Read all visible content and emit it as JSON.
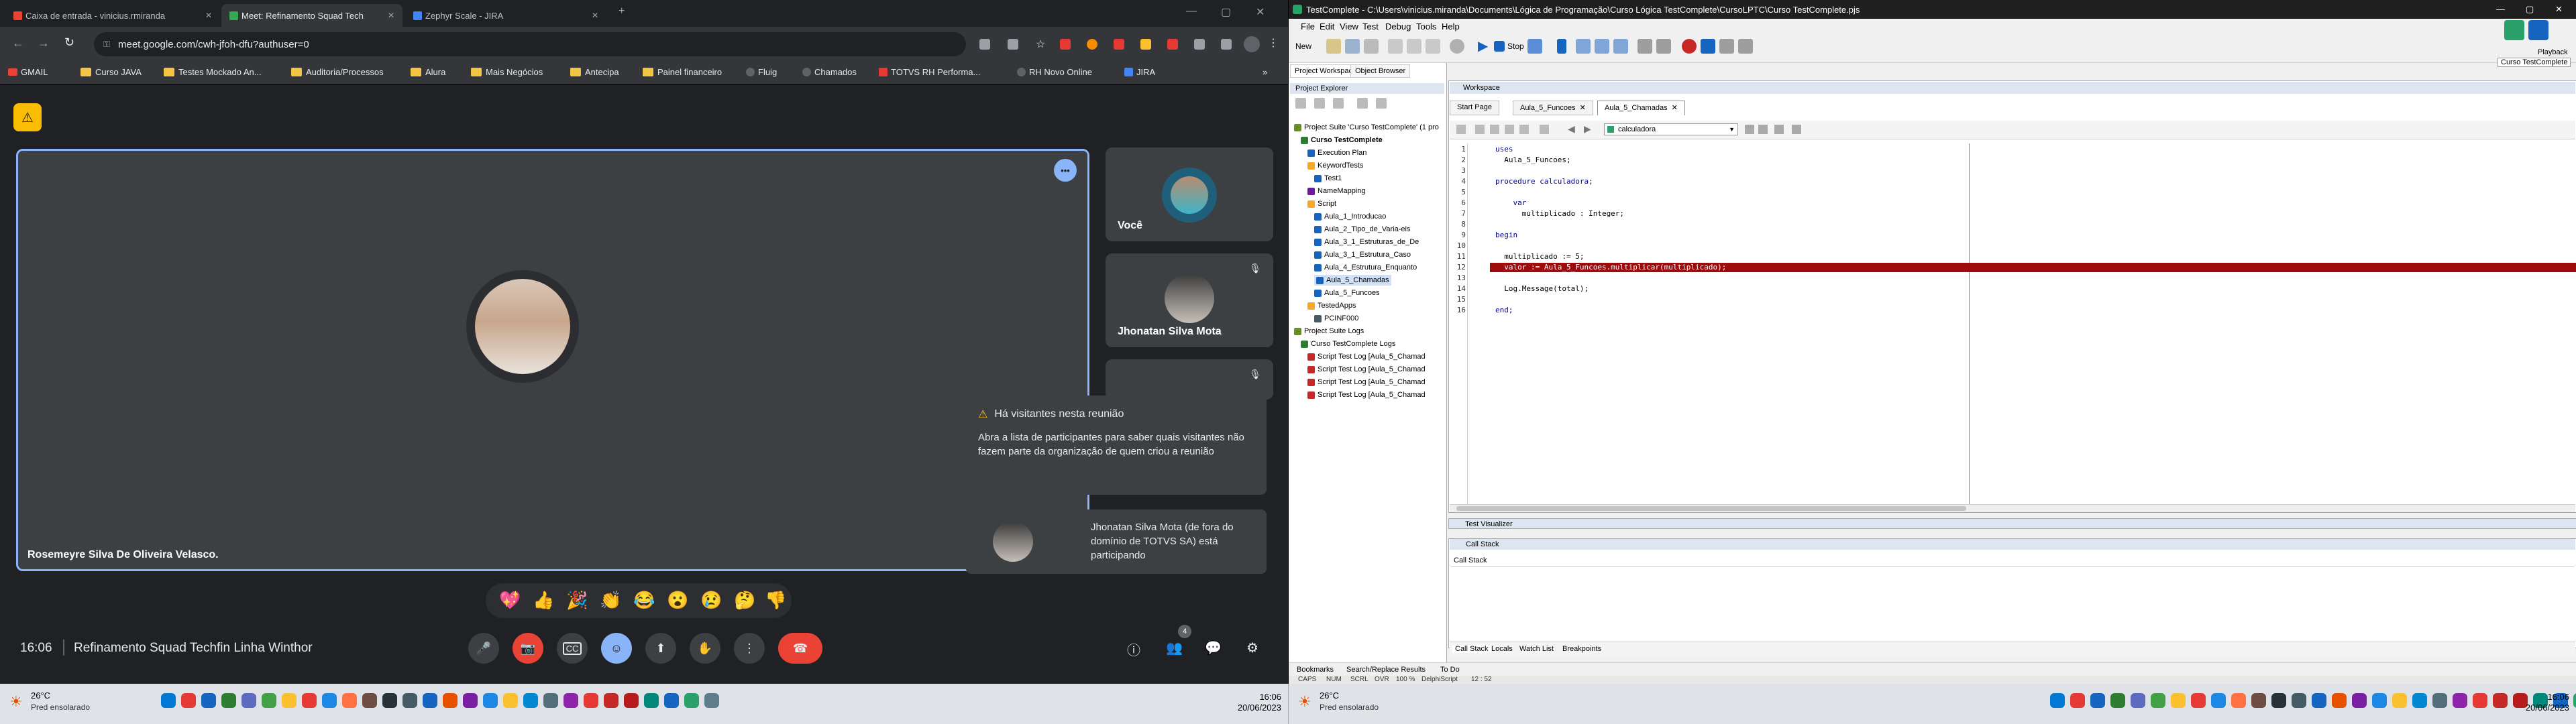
{
  "chrome": {
    "tabs": [
      {
        "label": "Caixa de entrada - vinicius.rmiranda",
        "color": "#ea4335"
      },
      {
        "label": "Meet: Refinamento Squad Tech",
        "color": "#34a853",
        "active": true
      },
      {
        "label": "Zephyr Scale - JIRA",
        "color": "#4285f4"
      }
    ],
    "url": "meet.google.com/cwh-jfoh-dfu?authuser=0",
    "bookmarks": [
      "GMAIL",
      "Curso JAVA",
      "Testes Mockado An...",
      "Auditoria/Processos",
      "Alura",
      "Mais Negócios",
      "Antecipa",
      "Painel financeiro",
      "Fluig",
      "Chamados",
      "TOTVS RH Performa...",
      "RH Novo Online",
      "JIRA"
    ]
  },
  "meet": {
    "main_speaker": "Rosemeyre Silva De Oliveira Velasco.",
    "tiles": [
      {
        "name": "Você"
      },
      {
        "name": "Jhonatan Silva Mota"
      }
    ],
    "toast_title": "Há visitantes nesta reunião",
    "toast_body": "Abra a lista de participantes para saber quais visitantes não fazem parte da organização de quem criou a reunião",
    "toast2_text": "Jhonatan Silva Mota (de fora do domínio de TOTVS SA) está participando",
    "time": "16:06",
    "meeting_name": "Refinamento Squad Techfin Linha Winthor",
    "participants_count": "4",
    "reactions": [
      "💖",
      "👍",
      "🎉",
      "👏",
      "😂",
      "😮",
      "😢",
      "🤔",
      "👎"
    ]
  },
  "tc": {
    "title": "TestComplete - C:\\Users\\vinicius.miranda\\Documents\\Lógica de Programação\\Curso Lógica TestComplete\\CursoLPTC\\Curso TestComplete.pjs",
    "menu": [
      "File",
      "Edit",
      "View",
      "Test",
      "Debug",
      "Tools",
      "Help"
    ],
    "toolbar": {
      "new_label": "New",
      "stop_label": "Stop",
      "playback_label": "Playback",
      "project_tooltip": "Curso TestComplete"
    },
    "left_tabs": [
      "Project Workspace",
      "Object Browser"
    ],
    "explorer_title": "Project Explorer",
    "tree": [
      {
        "label": "Project Suite 'Curso TestComplete' (1 pro",
        "indent": 0,
        "color": "#6b8e23"
      },
      {
        "label": "Curso TestComplete",
        "indent": 1,
        "color": "#2e7d32",
        "bold": true
      },
      {
        "label": "Execution Plan",
        "indent": 2,
        "color": "#1565c0"
      },
      {
        "label": "KeywordTests",
        "indent": 2,
        "color": "#f9a825"
      },
      {
        "label": "Test1",
        "indent": 3,
        "color": "#1565c0"
      },
      {
        "label": "NameMapping",
        "indent": 2,
        "color": "#6a1b9a"
      },
      {
        "label": "Script",
        "indent": 2,
        "color": "#f9a825"
      },
      {
        "label": "Aula_1_Introducao",
        "indent": 3,
        "color": "#1565c0"
      },
      {
        "label": "Aula_2_Tipo_de_Varia-eis",
        "indent": 3,
        "color": "#1565c0"
      },
      {
        "label": "Aula_3_1_Estruturas_de_De",
        "indent": 3,
        "color": "#1565c0"
      },
      {
        "label": "Aula_3_1_Estrutura_Caso",
        "indent": 3,
        "color": "#1565c0"
      },
      {
        "label": "Aula_4_Estrutura_Enquanto",
        "indent": 3,
        "color": "#1565c0"
      },
      {
        "label": "Aula_5_Chamadas",
        "indent": 3,
        "color": "#1565c0",
        "selected": true
      },
      {
        "label": "Aula_5_Funcoes",
        "indent": 3,
        "color": "#1565c0"
      },
      {
        "label": "TestedApps",
        "indent": 2,
        "color": "#f9a825"
      },
      {
        "label": "PCINF000",
        "indent": 3,
        "color": "#455a64"
      },
      {
        "label": "Project Suite Logs",
        "indent": 0,
        "color": "#6b8e23"
      },
      {
        "label": "Curso TestComplete Logs",
        "indent": 1,
        "color": "#2e7d32"
      },
      {
        "label": "Script Test Log [Aula_5_Chamad",
        "indent": 2,
        "color": "#c62828"
      },
      {
        "label": "Script Test Log [Aula_5_Chamad",
        "indent": 2,
        "color": "#c62828"
      },
      {
        "label": "Script Test Log [Aula_5_Chamad",
        "indent": 2,
        "color": "#c62828"
      },
      {
        "label": "Script Test Log [Aula_5_Chamad",
        "indent": 2,
        "color": "#c62828"
      }
    ],
    "workspace_title": "Workspace",
    "doc_tabs": [
      "Start Page",
      "Aula_5_Funcoes",
      "Aula_5_Chamadas"
    ],
    "routine_select": "calculadora",
    "code": [
      "uses",
      "  Aula_5_Funcoes;",
      "",
      "procedure calculadora;",
      "",
      "    var",
      "      multiplicado : Integer;",
      "",
      "begin",
      "",
      "  multiplicado := 5;",
      "  valor := Aula_5_Funcoes.multiplicar(multiplicado);",
      "",
      "  Log.Message(total);",
      "",
      "end;"
    ],
    "error_line": 12,
    "test_visualizer": "Test Visualizer",
    "call_stack_title": "Call Stack",
    "call_stack_header": "Call Stack",
    "bottom_tabs": [
      "Call Stack",
      "Locals",
      "Watch List",
      "Breakpoints"
    ],
    "lower_tabs": [
      "Bookmarks",
      "Search/Replace Results",
      "To Do"
    ],
    "status": [
      "CAPS",
      "NUM",
      "SCRL",
      "OVR",
      "100 %",
      "DelphiScript",
      "12 : 52"
    ]
  },
  "taskbar": {
    "weather_temp": "26°C",
    "weather_desc": "Pred ensolarado",
    "time": "16:06",
    "date": "20/06/2023"
  }
}
